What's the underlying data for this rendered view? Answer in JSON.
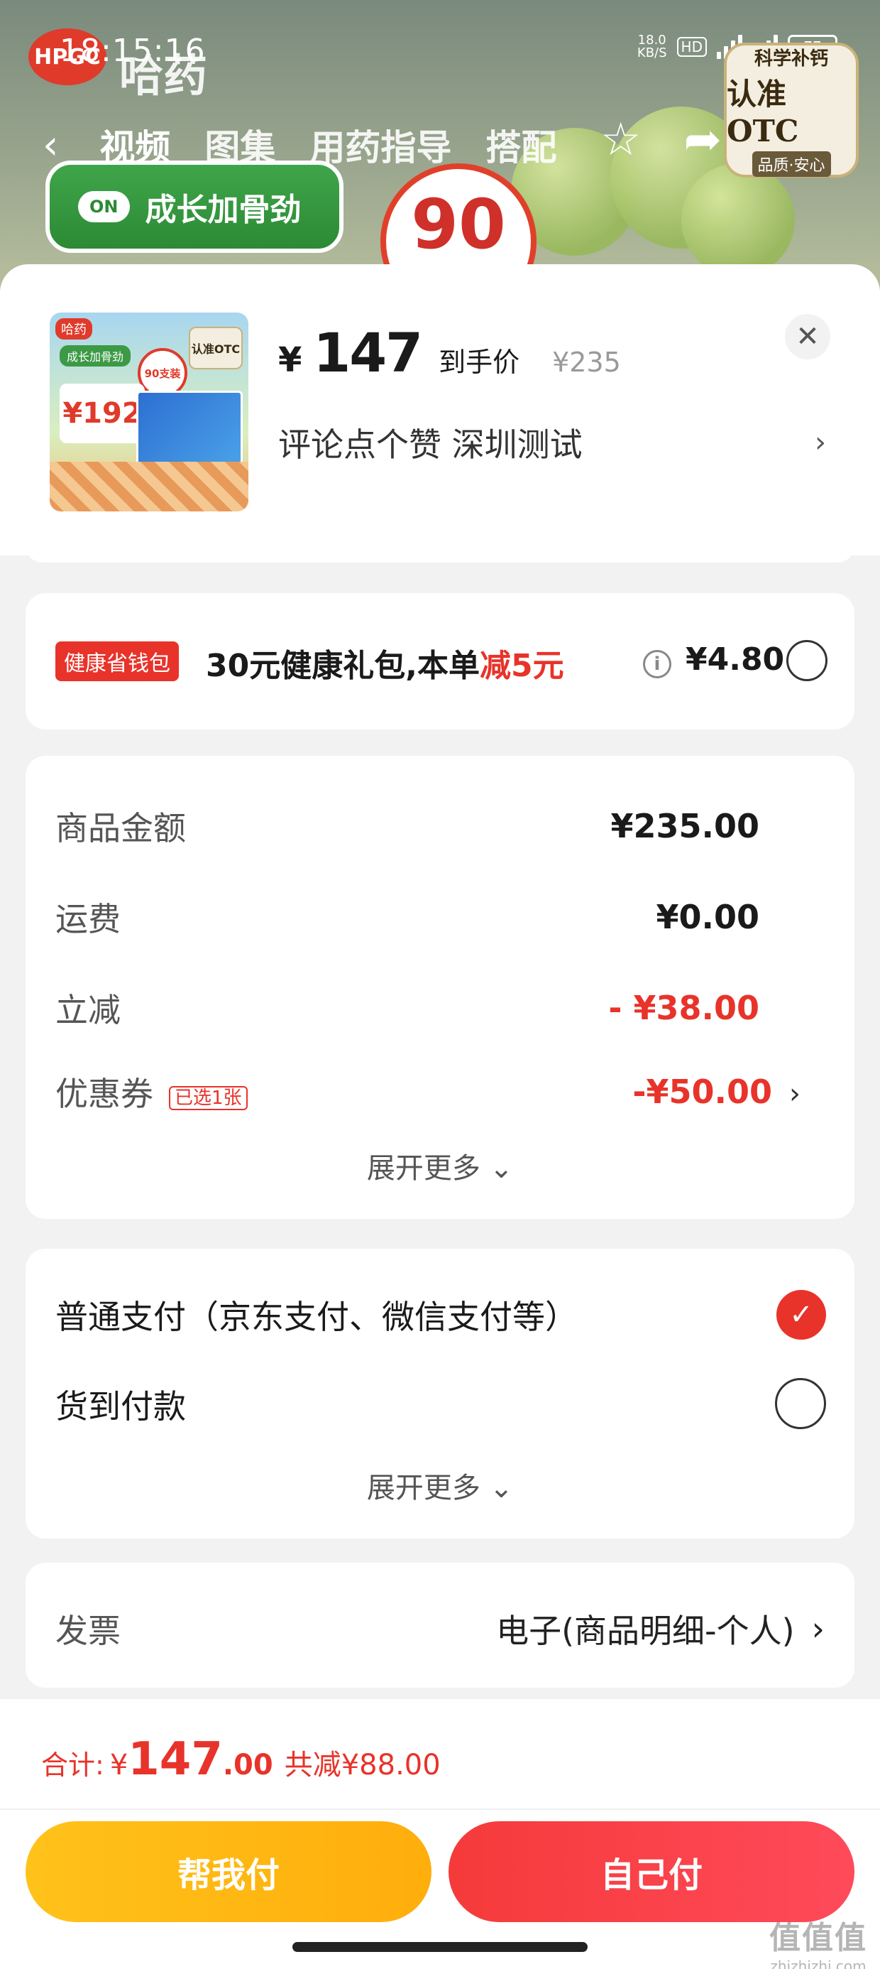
{
  "status_bar": {
    "time": "18:15:16",
    "net_speed_value": "18.0",
    "net_speed_unit": "KB/S",
    "hd": "HD",
    "battery": "77"
  },
  "background_page": {
    "brand_logo_text": "HPGC",
    "brand_name": "哈药",
    "otc_badge": {
      "line1": "科学补钙",
      "line2": "认准OTC",
      "line3": "品质·安心"
    },
    "nav_tabs": [
      "视频",
      "图集",
      "用药指导",
      "搭配"
    ],
    "grow_pill_toggle": "ON",
    "grow_pill_text": "成长加骨劲",
    "promo_number": "90"
  },
  "product": {
    "currency": "¥",
    "price": "147",
    "price_label": "到手价",
    "original_price": "¥235",
    "spec": "评论点个赞  深圳测试",
    "thumb": {
      "brand": "哈药",
      "pill": "成长加骨劲",
      "price": "¥192",
      "badge": "90支装",
      "otc": "认准OTC"
    }
  },
  "gift": {
    "tag": "健康省钱包",
    "text_prefix": "30元健康礼包,本单",
    "text_highlight": "减5元",
    "amount": "¥4.80",
    "selected": false
  },
  "fees": {
    "rows": [
      {
        "label": "商品金额",
        "value": "¥235.00",
        "red": false
      },
      {
        "label": "运费",
        "value": "¥0.00",
        "red": false
      },
      {
        "label": "立减",
        "value": "- ¥38.00",
        "red": true
      },
      {
        "label": "优惠券",
        "tag": "已选1张",
        "value": "-¥50.00",
        "red": true
      }
    ],
    "expand_label": "展开更多"
  },
  "payment": {
    "options": [
      {
        "label": "普通支付（京东支付、微信支付等）",
        "selected": true
      },
      {
        "label": "货到付款",
        "selected": false
      }
    ],
    "expand_label": "展开更多"
  },
  "invoice": {
    "label": "发票",
    "value": "电子(商品明细-个人)"
  },
  "footer": {
    "total_label": "合计:",
    "currency": "¥",
    "total_int": "147",
    "total_dec": ".00",
    "saved": "共减¥88.00",
    "help_pay_label": "帮我付",
    "self_pay_label": "自己付"
  },
  "watermark": {
    "line1": "值值值",
    "line2": "zhizhizhi.com"
  },
  "colors": {
    "accent_red": "#e8332a",
    "help_pay_yellow": "#ffb915",
    "self_pay_red": "#f53a3a"
  }
}
